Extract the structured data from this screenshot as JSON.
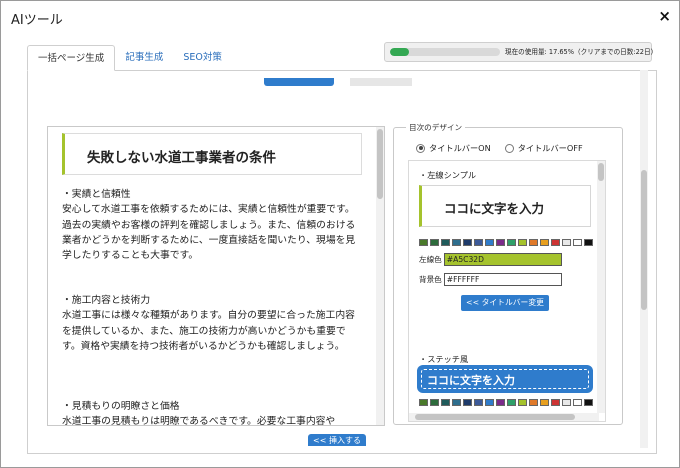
{
  "window": {
    "title": "AIツール",
    "close_glyph": "×"
  },
  "tabs": [
    {
      "label": "一括ページ生成",
      "active": true
    },
    {
      "label": "記事生成",
      "active": false
    },
    {
      "label": "SEO対策",
      "active": false
    }
  ],
  "usage": {
    "text": "現在の使用量: 17.65%（クリアまでの日数:22日）",
    "percent": 17.65,
    "bar_color": "#34a853"
  },
  "article": {
    "title": "失敗しない水道工事業者の条件",
    "sections": [
      {
        "heading": "・実績と信頼性",
        "body": "安心して水道工事を依頼するためには、実績と信頼性が重要です。過去の実績やお客様の評判を確認しましょう。また、信頼のおける業者かどうかを判断するために、一度直接話を聞いたり、現場を見学したりすることも大事です。"
      },
      {
        "heading": "・施工内容と技術力",
        "body": "水道工事には様々な種類があります。自分の要望に合った施工内容を提供しているか、また、施工の技術力が高いかどうかも重要です。資格や実績を持つ技術者がいるかどうかも確認しましょう。"
      },
      {
        "heading": "・見積もりの明瞭さと価格",
        "body": "水道工事の見積もりは明瞭であるべきです。必要な工事内容や"
      }
    ],
    "insert_button": "<< 挿入する"
  },
  "design": {
    "legend": "目次のデザイン",
    "radio_on": "タイトルバーON",
    "radio_off": "タイトルバーOFF",
    "style1_label": "・左線シンプル",
    "style1_preview": "ココに文字を入力",
    "line_color_label": "左線色",
    "line_color_value": "#A5C32D",
    "bg_color_label": "背景色",
    "bg_color_value": "#FFFFFF",
    "change_button": "<< タイトルバー変更",
    "style2_label": "・ステッチ風",
    "style2_preview": "ココに文字を入力",
    "swatch_colors": [
      "#4a7a2a",
      "#2d6b3c",
      "#1e5b5b",
      "#2e6e8e",
      "#1f3b6b",
      "#3c5a99",
      "#2f7ccc",
      "#7a2a8a",
      "#2fa06a",
      "#a5c32d",
      "#e07a2a",
      "#e8a020",
      "#cc3333",
      "#e8e8e8",
      "#ffffff",
      "#111111"
    ],
    "accent": "#2f7ccc"
  }
}
